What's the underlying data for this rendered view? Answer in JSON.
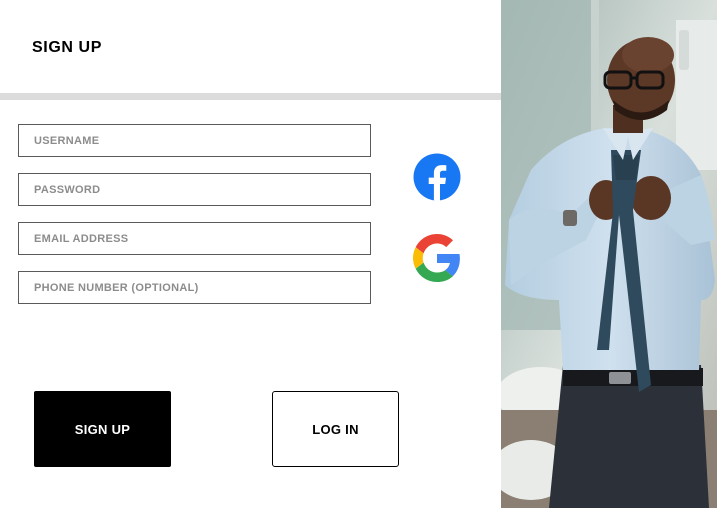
{
  "page": {
    "title": "SIGN UP"
  },
  "form": {
    "fields": [
      {
        "name": "username",
        "placeholder": "USERNAME",
        "value": ""
      },
      {
        "name": "password",
        "placeholder": "PASSWORD",
        "value": ""
      },
      {
        "name": "email",
        "placeholder": "EMAIL ADDRESS",
        "value": ""
      },
      {
        "name": "phone",
        "placeholder": "PHONE NUMBER (OPTIONAL)",
        "value": ""
      }
    ]
  },
  "social": {
    "facebook": {
      "icon": "facebook-icon",
      "color": "#1877F2"
    },
    "google": {
      "icon": "google-icon",
      "colors": [
        "#4285F4",
        "#EA4335",
        "#FBBC05",
        "#34A853"
      ]
    }
  },
  "buttons": {
    "signup_label": "SIGN UP",
    "login_label": "LOG IN"
  },
  "colors": {
    "divider": "#dcdcdc",
    "primary": "#000000"
  }
}
